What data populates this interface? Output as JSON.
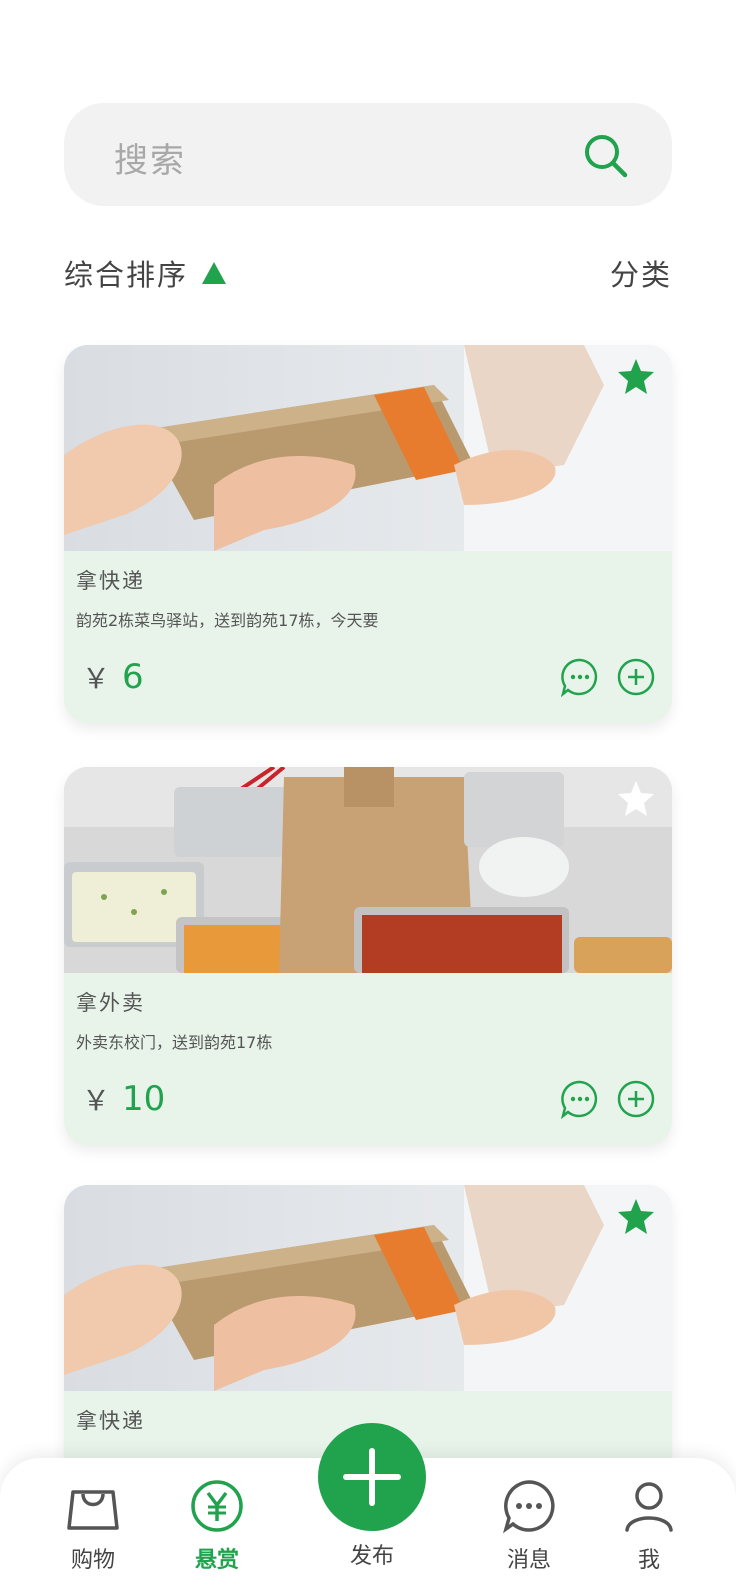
{
  "search": {
    "placeholder": "搜索"
  },
  "sort": {
    "label": "综合排序",
    "category_label": "分类"
  },
  "colors": {
    "accent": "#21a34e",
    "card_bg": "#e8f4ea",
    "star_inactive": "#ffffff"
  },
  "cards": [
    {
      "title": "拿快递",
      "desc": "韵苑2栋菜鸟驿站，送到韵苑17栋，今天要",
      "currency": "￥",
      "price": "6",
      "favorited": true,
      "image": "package-handoff"
    },
    {
      "title": "拿外卖",
      "desc": "外卖东校门，送到韵苑17栋",
      "currency": "￥",
      "price": "10",
      "favorited": false,
      "image": "takeout-food"
    },
    {
      "title": "拿快递",
      "favorited": true,
      "image": "package-handoff"
    }
  ],
  "tabs": [
    {
      "label": "购物",
      "icon": "shopping-bag-icon",
      "active": false
    },
    {
      "label": "悬赏",
      "icon": "reward-yen-icon",
      "active": true
    },
    {
      "label": "发布",
      "icon": "plus-icon",
      "active": false
    },
    {
      "label": "消息",
      "icon": "message-icon",
      "active": false
    },
    {
      "label": "我",
      "icon": "profile-icon",
      "active": false
    }
  ]
}
